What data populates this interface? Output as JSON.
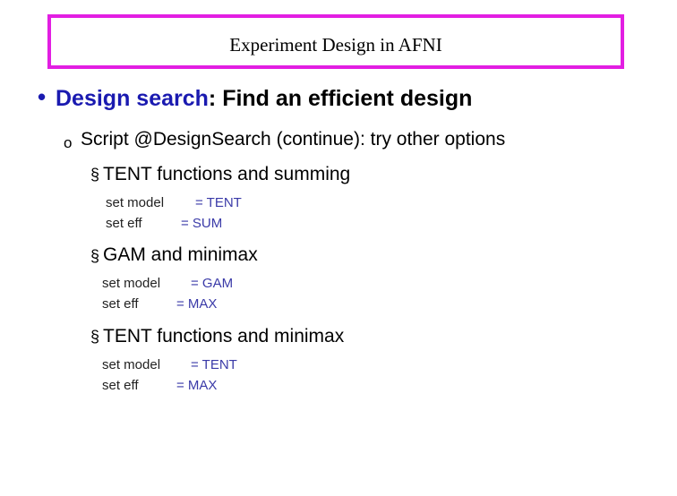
{
  "title": "Experiment Design in AFNI",
  "heading": {
    "bullet": "•",
    "accent": "Design search",
    "rest": ": Find an efficient design"
  },
  "subheading": {
    "marker": "o",
    "text": "Script @DesignSearch (continue): try other options"
  },
  "sections": [
    {
      "marker": "§",
      "title": "TENT functions and summing",
      "settings": [
        {
          "label": "set model",
          "value": "= TENT"
        },
        {
          "label": "set eff",
          "value": "= SUM"
        }
      ]
    },
    {
      "marker": "§",
      "title": "GAM and minimax",
      "settings": [
        {
          "label": "set model",
          "value": "= GAM"
        },
        {
          "label": "set eff",
          "value": "= MAX"
        }
      ]
    },
    {
      "marker": "§",
      "title": "TENT functions and minimax",
      "settings": [
        {
          "label": "set model",
          "value": "= TENT"
        },
        {
          "label": "set eff",
          "value": "= MAX"
        }
      ]
    }
  ],
  "colors": {
    "title_border": "#e21ee2",
    "accent_text": "#1a1ab0",
    "value_text": "#3a3aa8"
  }
}
